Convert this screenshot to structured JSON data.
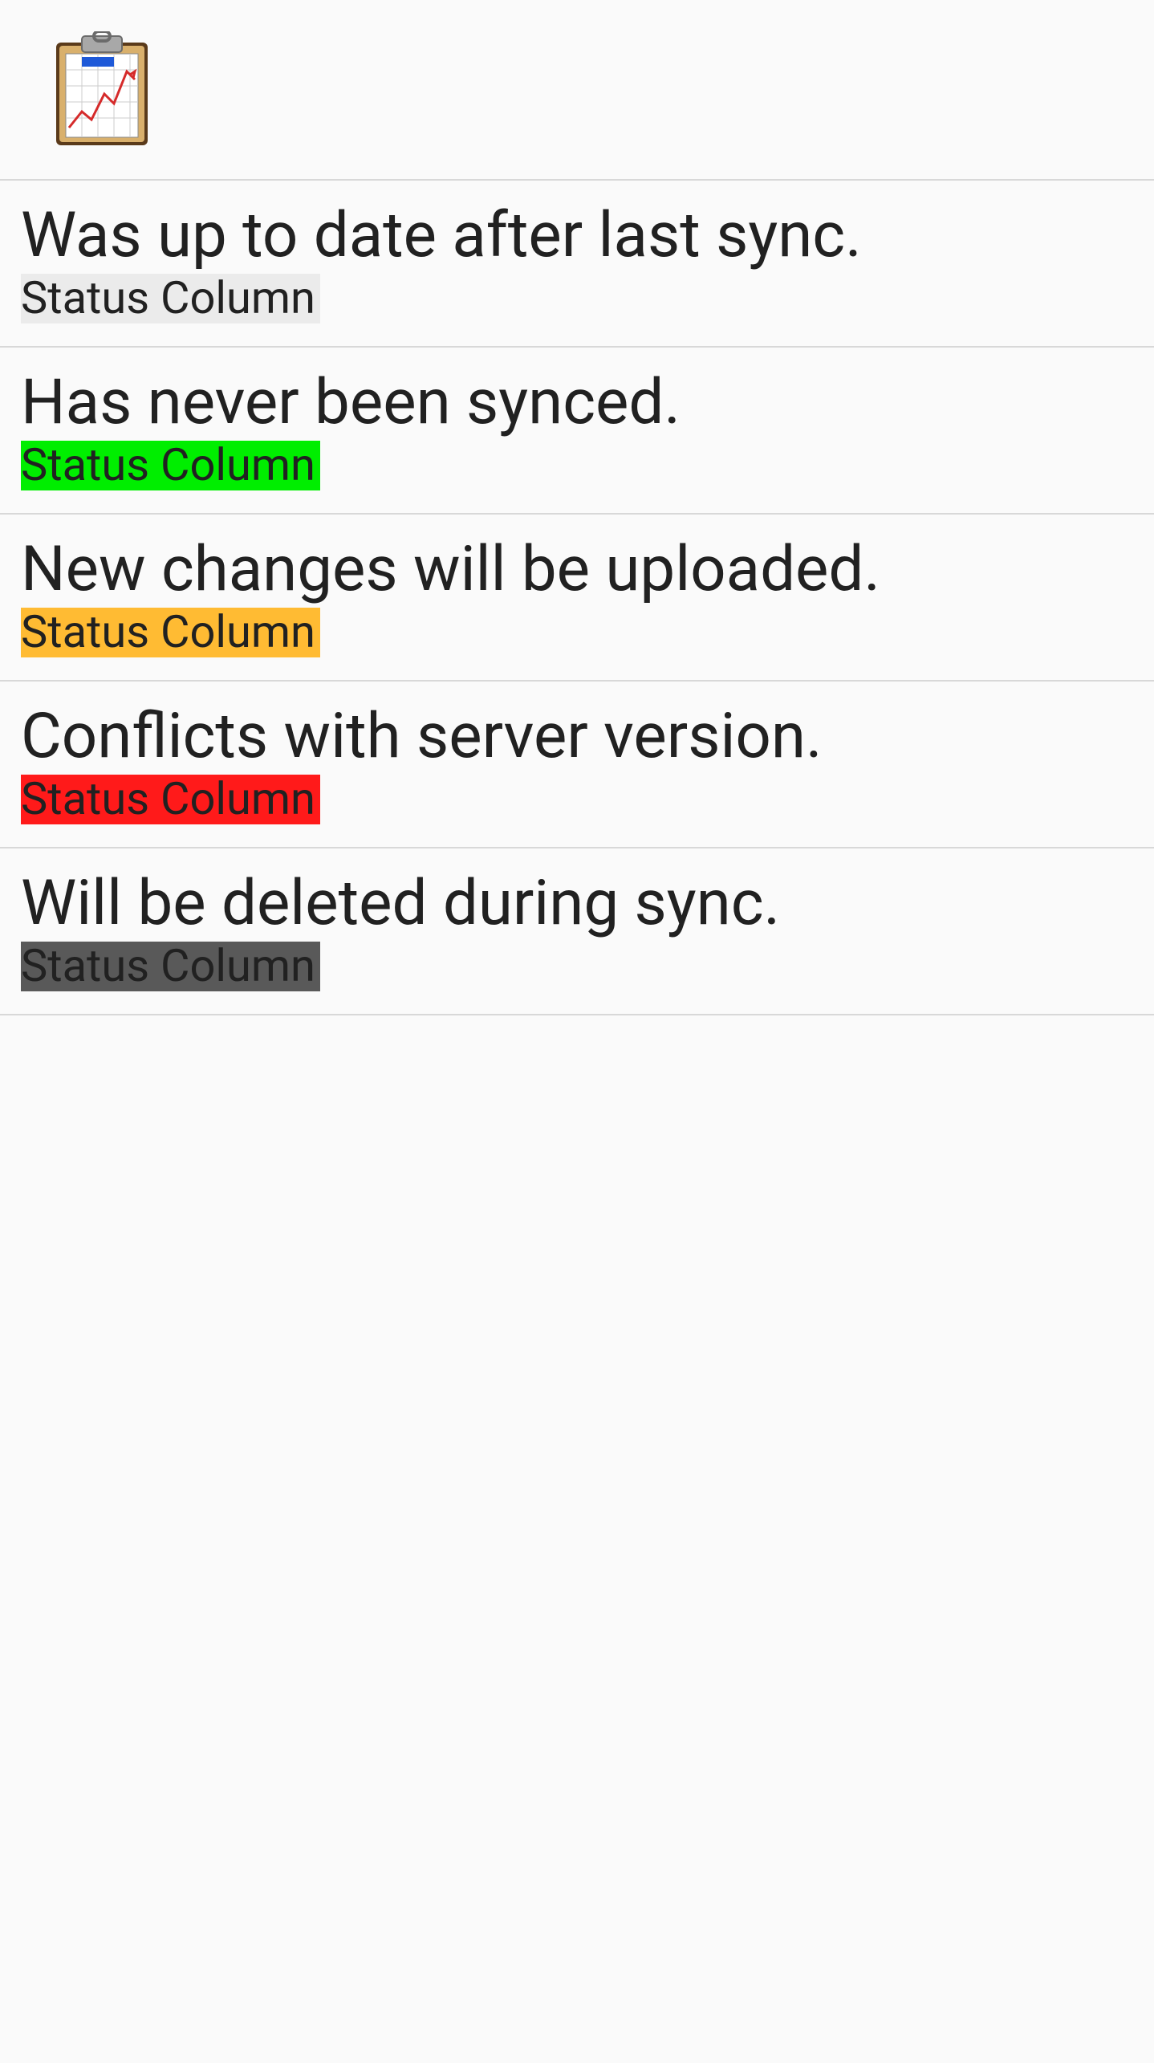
{
  "statusLabel": "Status Column",
  "items": [
    {
      "title": "Was up to date after last sync.",
      "badgeClass": "badge-upToDate"
    },
    {
      "title": "Has never been synced.",
      "badgeClass": "badge-neverSynced"
    },
    {
      "title": "New changes will be uploaded.",
      "badgeClass": "badge-newChanges"
    },
    {
      "title": "Conflicts with server version.",
      "badgeClass": "badge-conflict"
    },
    {
      "title": "Will be deleted during sync.",
      "badgeClass": "badge-willDelete"
    }
  ]
}
